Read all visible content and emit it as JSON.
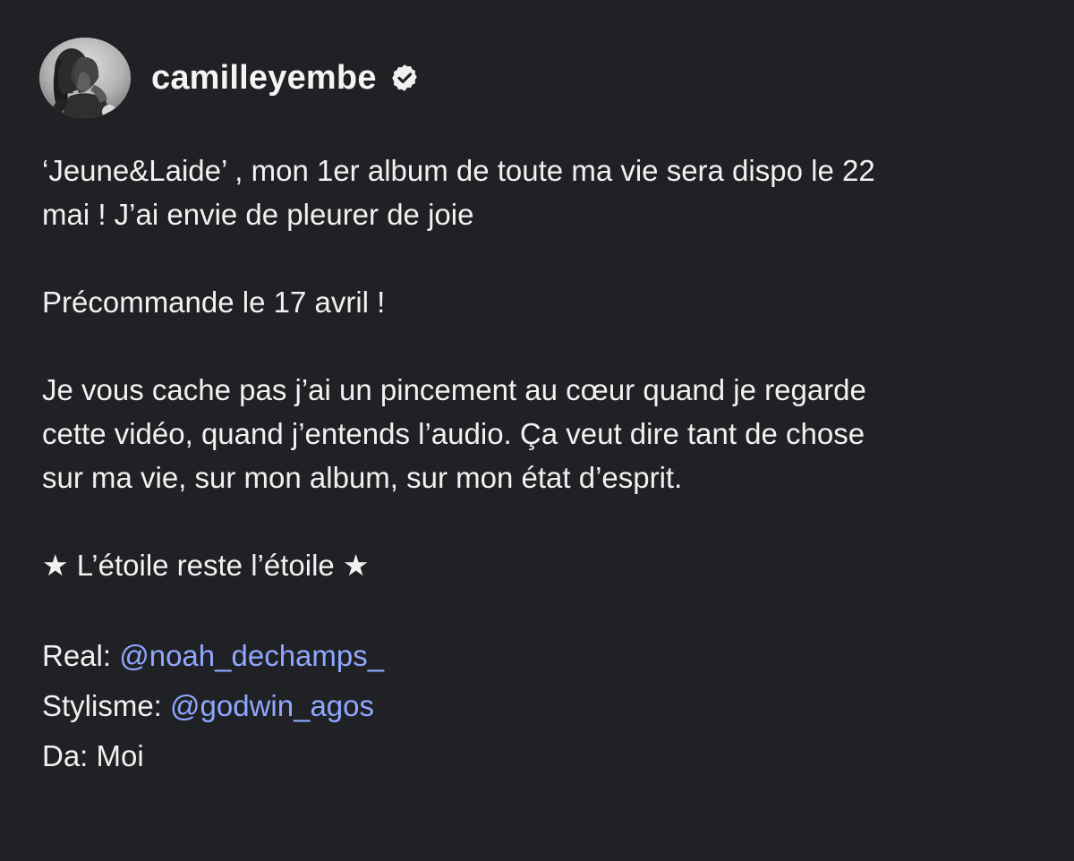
{
  "post": {
    "author": {
      "username": "camilleyembe",
      "avatar_icon": "profile-avatar",
      "verified_icon": "verified-badge-icon"
    },
    "caption": {
      "paragraph1": {
        "line1": "‘Jeune&Laide’ , mon 1er album de toute ma vie sera dispo le 22",
        "line2": "mai ! J’ai envie de pleurer de joie"
      },
      "paragraph2": {
        "line1": "Précommande le 17 avril !"
      },
      "paragraph3": {
        "line1": "Je vous cache pas j’ai un pincement au cœur quand je regarde",
        "line2": "cette vidéo, quand j’entends l’audio. Ça veut dire tant de chose",
        "line3": "sur ma vie, sur mon album, sur mon état d’esprit."
      },
      "paragraph4": {
        "line1": "★ L’étoile reste l’étoile ★"
      },
      "credits": {
        "real_label": "Real:",
        "real_handle": "@noah_dechamps_",
        "stylisme_label": "Stylisme:",
        "stylisme_handle": "@godwin_agos",
        "da_line": "Da: Moi"
      }
    },
    "colors": {
      "background": "#202124",
      "text": "#f1f1f1",
      "mention": "#8fa7ff"
    }
  }
}
